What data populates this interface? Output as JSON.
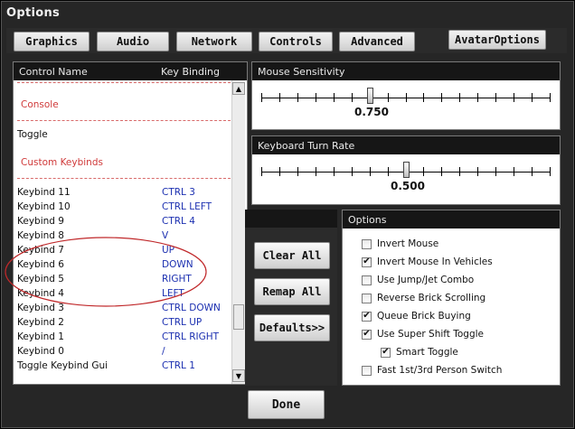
{
  "window": {
    "title": "Options"
  },
  "tabs": [
    {
      "label": "Graphics"
    },
    {
      "label": "Audio"
    },
    {
      "label": "Network"
    },
    {
      "label": "Controls"
    },
    {
      "label": "Advanced"
    }
  ],
  "avatar_options_label": "AvatarOptions",
  "keybind_list": {
    "col_name": "Control Name",
    "col_binding": "Key Binding",
    "sections": {
      "console": "Console",
      "custom": "Custom Keybinds"
    },
    "toggle_row": "Toggle",
    "rows": [
      {
        "name": "Keybind 11",
        "binding": "CTRL 3"
      },
      {
        "name": "Keybind 10",
        "binding": "CTRL LEFT"
      },
      {
        "name": "Keybind 9",
        "binding": "CTRL 4"
      },
      {
        "name": "Keybind 8",
        "binding": "V"
      },
      {
        "name": "Keybind 7",
        "binding": "UP"
      },
      {
        "name": "Keybind 6",
        "binding": "DOWN"
      },
      {
        "name": "Keybind 5",
        "binding": "RIGHT"
      },
      {
        "name": "Keybind 4",
        "binding": "LEFT"
      },
      {
        "name": "Keybind 3",
        "binding": "CTRL DOWN"
      },
      {
        "name": "Keybind 2",
        "binding": "CTRL UP"
      },
      {
        "name": "Keybind 1",
        "binding": "CTRL RIGHT"
      },
      {
        "name": "Keybind 0",
        "binding": "/"
      },
      {
        "name": "Toggle Keybind Gui",
        "binding": "CTRL 1"
      }
    ]
  },
  "mouse_sensitivity": {
    "label": "Mouse Sensitivity",
    "value_text": "0.750",
    "fraction": 0.375
  },
  "keyboard_turn_rate": {
    "label": "Keyboard Turn Rate",
    "value_text": "0.500",
    "fraction": 0.5
  },
  "buttons": {
    "clear_all": "Clear All",
    "remap_all": "Remap All",
    "defaults": "Defaults>>",
    "done": "Done"
  },
  "options": {
    "title": "Options",
    "items": [
      {
        "label": "Invert Mouse",
        "checked": false
      },
      {
        "label": "Invert Mouse In Vehicles",
        "checked": true
      },
      {
        "label": "Use Jump/Jet Combo",
        "checked": false
      },
      {
        "label": "Reverse Brick Scrolling",
        "checked": false
      },
      {
        "label": "Queue Brick Buying",
        "checked": true
      },
      {
        "label": "Use Super Shift Toggle",
        "checked": true
      },
      {
        "label": "Smart Toggle",
        "checked": true
      },
      {
        "label": "Fast 1st/3rd Person Switch",
        "checked": false
      }
    ]
  },
  "colors": {
    "annotation": "#c0282a",
    "binding_text": "#1b2fb0",
    "section_text": "#d03a3a"
  }
}
